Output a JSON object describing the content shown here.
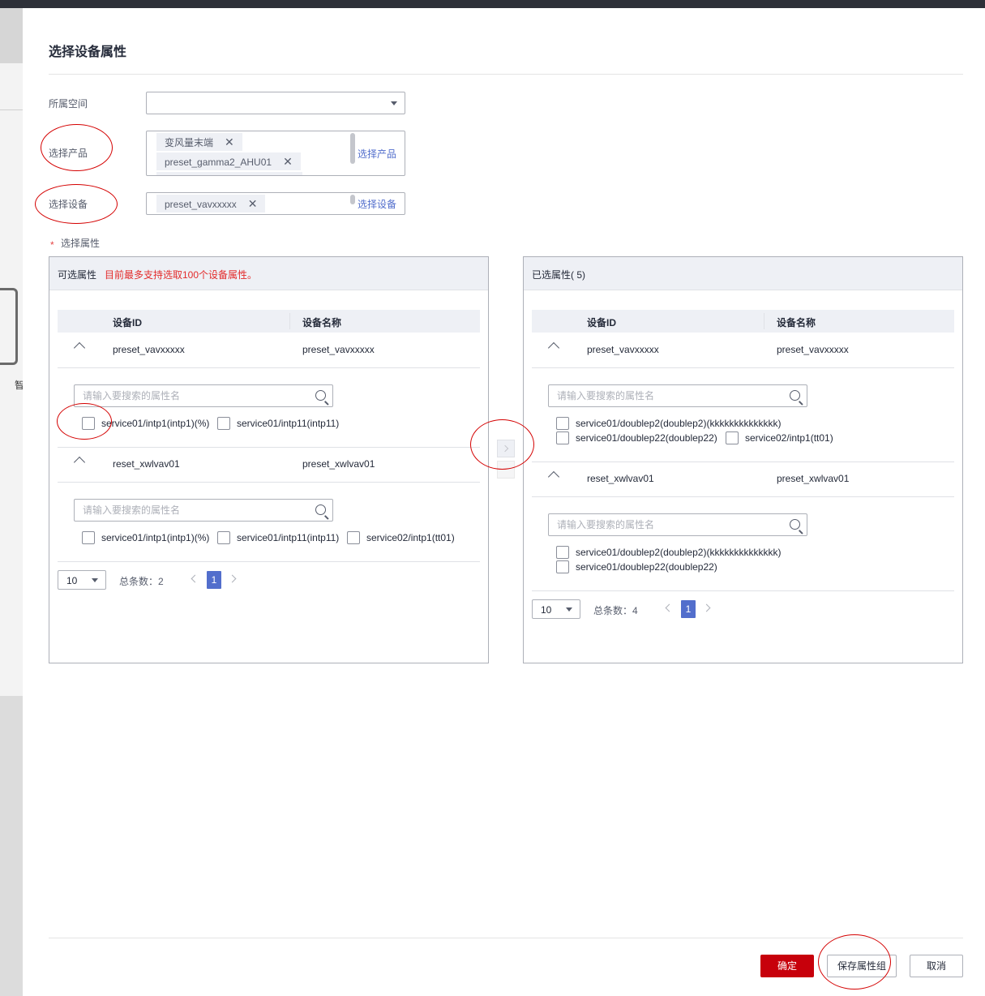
{
  "background": {
    "partial_text": "智"
  },
  "dialog": {
    "title": "选择设备属性",
    "space_label": "所属空间",
    "space_value": "",
    "product_label": "选择产品",
    "product_tags": [
      "变风量末端",
      "preset_gamma2_AHU01"
    ],
    "product_link": "选择产品",
    "device_label": "选择设备",
    "device_tags": [
      "preset_vavxxxxx"
    ],
    "device_link": "选择设备",
    "attr_label": "选择属性",
    "required_mark": "*"
  },
  "left_panel": {
    "title": "可选属性",
    "warning": "目前最多支持选取100个设备属性。",
    "col_id": "设备ID",
    "col_name": "设备名称",
    "search_placeholder": "请输入要搜索的属性名",
    "devices": [
      {
        "id": "preset_vavxxxxx",
        "name": "preset_vavxxxxx",
        "attrs": [
          "service01/intp1(intp1)(%)",
          "service01/intp11(intp11)"
        ]
      },
      {
        "id": "reset_xwlvav01",
        "name": "preset_xwlvav01",
        "attrs": [
          "service01/intp1(intp1)(%)",
          "service01/intp11(intp11)",
          "service02/intp1(tt01)"
        ]
      }
    ],
    "page_size": "10",
    "total": "总条数：2",
    "page": "1"
  },
  "right_panel": {
    "title": "已选属性( 5)",
    "col_id": "设备ID",
    "col_name": "设备名称",
    "search_placeholder": "请输入要搜索的属性名",
    "devices": [
      {
        "id": "preset_vavxxxxx",
        "name": "preset_vavxxxxx",
        "attrs": [
          "service01/doublep2(doublep2)(kkkkkkkkkkkkkk)",
          "service01/doublep22(doublep22)",
          "service02/intp1(tt01)"
        ]
      },
      {
        "id": "reset_xwlvav01",
        "name": "preset_xwlvav01",
        "attrs": [
          "service01/doublep2(doublep2)(kkkkkkkkkkkkkk)",
          "service01/doublep22(doublep22)"
        ]
      }
    ],
    "page_size": "10",
    "total": "总条数：4",
    "page": "1"
  },
  "footer": {
    "confirm": "确定",
    "save_group": "保存属性组",
    "cancel": "取消"
  },
  "colors": {
    "primary": "#c7000b",
    "link": "#526ecc",
    "annotation": "#d40000",
    "warning": "#e32b2b"
  }
}
